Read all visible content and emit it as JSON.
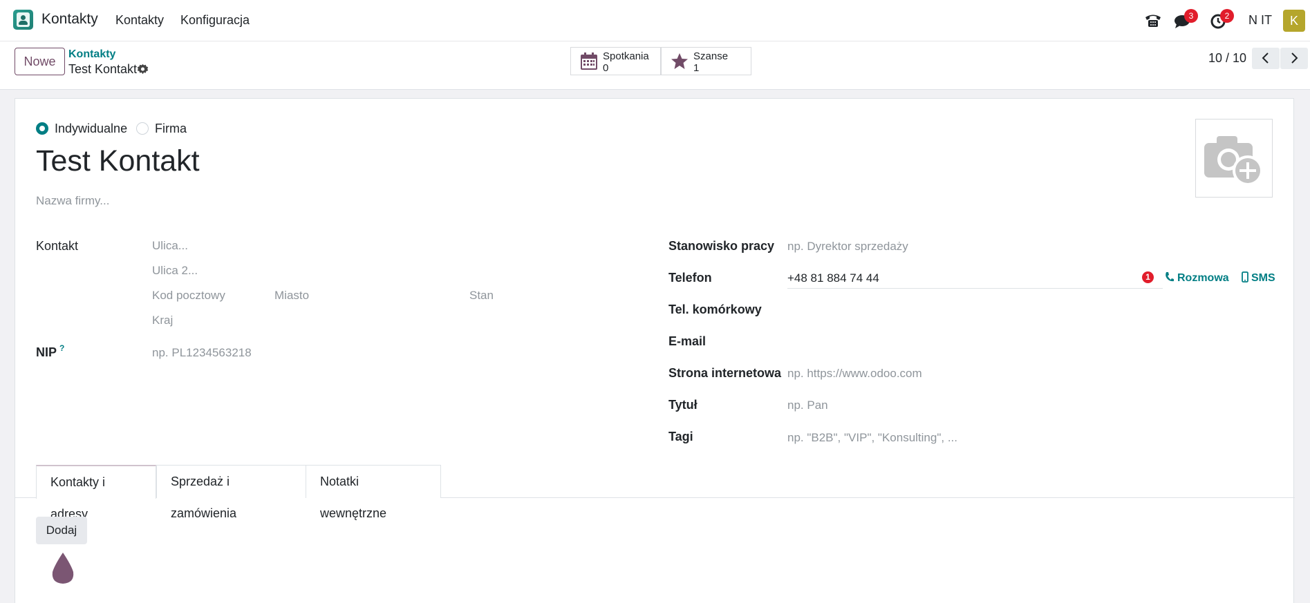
{
  "navbar": {
    "app_name": "Kontakty",
    "menu": [
      "Kontakty",
      "Konfiguracja"
    ],
    "messages_badge": "3",
    "activities_badge": "2",
    "company": "N IT",
    "avatar_letter": "K"
  },
  "control": {
    "new_button": "Nowe",
    "breadcrumb_parent": "Kontakty",
    "breadcrumb_current": "Test Kontakt",
    "meetings_label": "Spotkania",
    "meetings_value": "0",
    "opportunities_label": "Szanse",
    "opportunities_value": "1",
    "pager": "10 / 10"
  },
  "form": {
    "type_individual": "Indywidualne",
    "type_company": "Firma",
    "name": "Test Kontakt",
    "company_placeholder": "Nazwa firmy...",
    "address_label": "Kontakt",
    "street_ph": "Ulica...",
    "street2_ph": "Ulica 2...",
    "zip_ph": "Kod pocztowy",
    "city_ph": "Miasto",
    "state_ph": "Stan",
    "country_ph": "Kraj",
    "vat_label": "NIP",
    "vat_help": "?",
    "vat_ph": "np. PL1234563218",
    "job_label": "Stanowisko pracy",
    "job_ph": "np. Dyrektor sprzedaży",
    "phone_label": "Telefon",
    "phone_value": "+48 81 884 74 44",
    "phone_badge": "1",
    "call_link": "Rozmowa",
    "sms_link": "SMS",
    "mobile_label": "Tel. komórkowy",
    "email_label": "E-mail",
    "website_label": "Strona internetowa",
    "website_ph": "np. https://www.odoo.com",
    "title_label": "Tytuł",
    "title_ph": "np. Pan",
    "tags_label": "Tagi",
    "tags_ph": "np. \"B2B\", \"VIP\", \"Konsulting\", ..."
  },
  "tabs": [
    "Kontakty i adresy",
    "Sprzedaż i zamówienia",
    "Notatki wewnętrzne"
  ],
  "add_button": "Dodaj",
  "colors": {
    "brand": "#714b67",
    "accent": "#017e84",
    "badge": "#e11d2b"
  }
}
